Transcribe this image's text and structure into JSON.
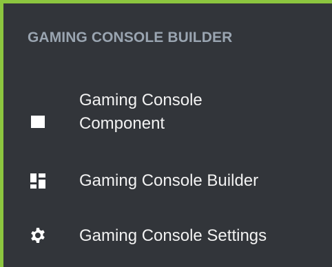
{
  "sidebar": {
    "title": "GAMING CONSOLE BUILDER",
    "items": [
      {
        "label": "Gaming Console Component",
        "icon": "square-icon"
      },
      {
        "label": "Gaming Console Builder",
        "icon": "layout-grid-icon"
      },
      {
        "label": "Gaming Console Settings",
        "icon": "gear-icon"
      }
    ]
  },
  "colors": {
    "accent_border": "#8cc63f",
    "panel_background": "#32353a",
    "title_text": "#9aa5b1",
    "item_text": "#f2f2f2"
  }
}
